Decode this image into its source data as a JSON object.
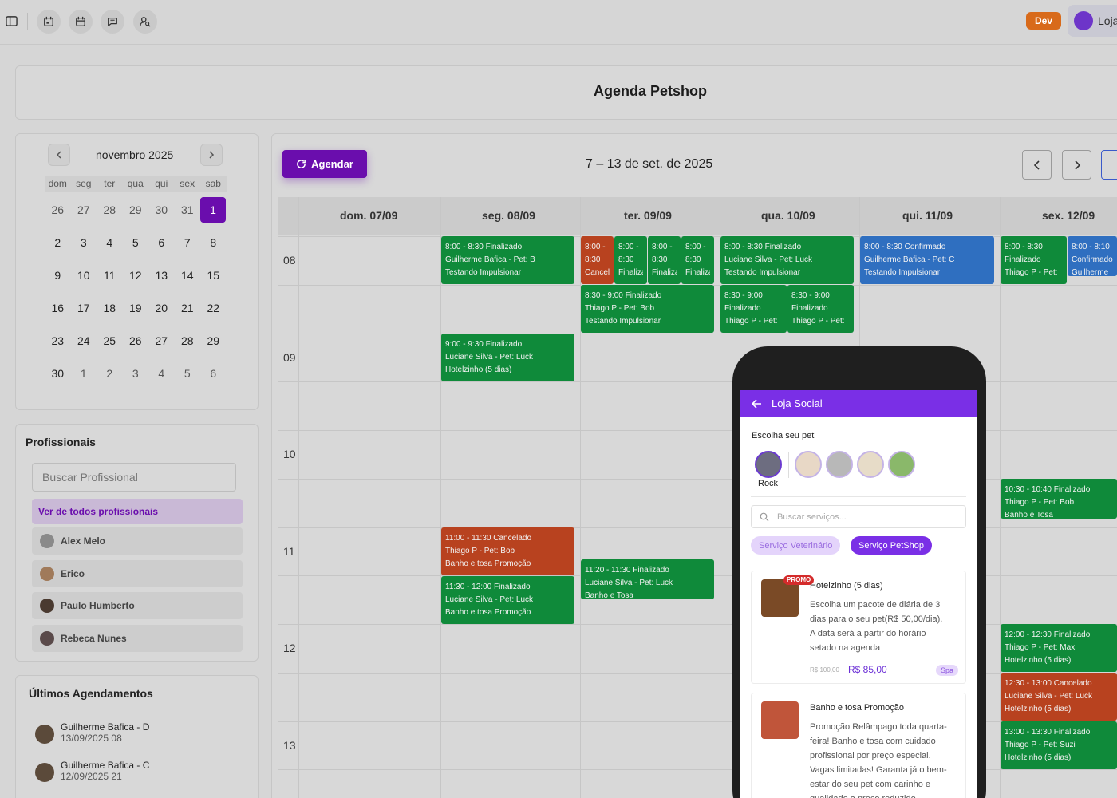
{
  "topbar": {
    "icons": [
      "sidebar-icon",
      "calendar-icon",
      "calendar-check-icon",
      "message-icon",
      "user-search-icon"
    ],
    "env_badge": "Dev",
    "user_label": "Loja"
  },
  "page": {
    "title": "Agenda Petshop"
  },
  "mini_calendar": {
    "month": "novembro 2025",
    "weekdays": [
      "dom",
      "seg",
      "ter",
      "qua",
      "qui",
      "sex",
      "sab"
    ],
    "days": [
      {
        "d": "26",
        "muted": true
      },
      {
        "d": "27",
        "muted": true
      },
      {
        "d": "28",
        "muted": true
      },
      {
        "d": "29",
        "muted": true
      },
      {
        "d": "30",
        "muted": true
      },
      {
        "d": "31",
        "muted": true
      },
      {
        "d": "1",
        "selected": true
      },
      {
        "d": "2"
      },
      {
        "d": "3"
      },
      {
        "d": "4"
      },
      {
        "d": "5"
      },
      {
        "d": "6"
      },
      {
        "d": "7"
      },
      {
        "d": "8"
      },
      {
        "d": "9"
      },
      {
        "d": "10"
      },
      {
        "d": "11"
      },
      {
        "d": "12"
      },
      {
        "d": "13"
      },
      {
        "d": "14"
      },
      {
        "d": "15"
      },
      {
        "d": "16"
      },
      {
        "d": "17"
      },
      {
        "d": "18"
      },
      {
        "d": "19"
      },
      {
        "d": "20"
      },
      {
        "d": "21"
      },
      {
        "d": "22"
      },
      {
        "d": "23"
      },
      {
        "d": "24"
      },
      {
        "d": "25"
      },
      {
        "d": "26"
      },
      {
        "d": "27"
      },
      {
        "d": "28"
      },
      {
        "d": "29"
      },
      {
        "d": "30"
      },
      {
        "d": "1",
        "muted": true
      },
      {
        "d": "2",
        "muted": true
      },
      {
        "d": "3",
        "muted": true
      },
      {
        "d": "4",
        "muted": true
      },
      {
        "d": "5",
        "muted": true
      },
      {
        "d": "6",
        "muted": true
      }
    ]
  },
  "profissionais": {
    "title": "Profissionais",
    "search_placeholder": "Buscar Profissional",
    "all_label": "Ver de todos profissionais",
    "items": [
      "Alex Melo",
      "Erico",
      "Paulo Humberto",
      "Rebeca Nunes"
    ]
  },
  "ultimos": {
    "title": "Últimos Agendamentos",
    "items": [
      {
        "name": "Guilherme Bafica - D",
        "date": "13/09/2025 08"
      },
      {
        "name": "Guilherme Bafica - C",
        "date": "12/09/2025 21"
      }
    ]
  },
  "agenda": {
    "agendar_label": "Agendar",
    "week_label": "7 – 13 de set. de 2025",
    "columns": [
      "dom. 07/09",
      "seg. 08/09",
      "ter. 09/09",
      "qua. 10/09",
      "qui. 11/09",
      "sex. 12/09"
    ],
    "hours": [
      "08",
      "09",
      "10",
      "11",
      "12",
      "13"
    ],
    "status_colors": {
      "Finalizado": "#0f8a3a",
      "Cancelado": "#b8421f",
      "Confirmado": "#2f6fc0"
    },
    "events": [
      {
        "status": "Finalizado",
        "lines": [
          "8:00 - 8:30 Finalizado",
          "Guilherme Bafica - Pet: B",
          "Testando Impulsionar"
        ]
      },
      {
        "status": "Cancelado",
        "lines": [
          "8:00 -",
          "8:30",
          "Cancela"
        ]
      },
      {
        "status": "Finalizado",
        "lines": [
          "8:00 -",
          "8:30",
          "Finaliza"
        ]
      },
      {
        "status": "Finalizado",
        "lines": [
          "8:00 -",
          "8:30",
          "Finaliza"
        ]
      },
      {
        "status": "Finalizado",
        "lines": [
          "8:00 -",
          "8:30",
          "Finaliza"
        ]
      },
      {
        "status": "Finalizado",
        "lines": [
          "8:30 - 9:00 Finalizado",
          "Thiago P - Pet: Bob",
          "Testando Impulsionar"
        ]
      },
      {
        "status": "Finalizado",
        "lines": [
          "8:00 - 8:30 Finalizado",
          "Luciane Silva - Pet: Luck",
          "Testando Impulsionar"
        ]
      },
      {
        "status": "Finalizado",
        "lines": [
          "8:30 - 9:00",
          "Finalizado",
          "Thiago P - Pet:"
        ]
      },
      {
        "status": "Finalizado",
        "lines": [
          "8:30 - 9:00",
          "Finalizado",
          "Thiago P - Pet:"
        ]
      },
      {
        "status": "Confirmado",
        "lines": [
          "8:00 - 8:30 Confirmado",
          "Guilherme Bafica - Pet: C",
          "Testando Impulsionar"
        ]
      },
      {
        "status": "Finalizado",
        "lines": [
          "8:00 - 8:30",
          "Finalizado",
          "Thiago P - Pet:"
        ]
      },
      {
        "status": "Confirmado",
        "lines": [
          "8:00 - 8:10",
          "Confirmado",
          "Guilherme"
        ]
      },
      {
        "status": "Finalizado",
        "lines": [
          "9:00 - 9:30 Finalizado",
          "Luciane Silva - Pet: Luck",
          "Hotelzinho (5 dias)"
        ]
      },
      {
        "status": "Finalizado",
        "lines": [
          "10:30 - 10:40 Finalizado",
          "Thiago P - Pet: Bob",
          "Banho e Tosa"
        ]
      },
      {
        "status": "Cancelado",
        "lines": [
          "11:00 - 11:30 Cancelado",
          "Thiago P - Pet: Bob",
          "Banho e tosa Promoção"
        ]
      },
      {
        "status": "Finalizado",
        "lines": [
          "11:30 - 12:00 Finalizado",
          "Luciane Silva - Pet: Luck",
          "Banho e tosa Promoção"
        ]
      },
      {
        "status": "Finalizado",
        "lines": [
          "11:20 - 11:30 Finalizado",
          "Luciane Silva - Pet: Luck",
          "Banho e Tosa"
        ]
      },
      {
        "status": "Finalizado",
        "lines": [
          "12:00 - 12:30 Finalizado",
          "Thiago P - Pet: Max",
          "Hotelzinho (5 dias)"
        ]
      },
      {
        "status": "Cancelado",
        "lines": [
          "12:30 - 13:00 Cancelado",
          "Luciane Silva - Pet: Luck",
          "Hotelzinho (5 dias)"
        ]
      },
      {
        "status": "Finalizado",
        "lines": [
          "13:00 - 13:30 Finalizado",
          "Thiago P - Pet: Suzi",
          "Hotelzinho (5 dias)"
        ]
      }
    ]
  },
  "phone": {
    "header_title": "Loja Social",
    "choose_pet": "Escolha seu pet",
    "selected_pet": "Rock",
    "search_placeholder": "Buscar serviços...",
    "chips": [
      "Serviço Veterinário",
      "Serviço PetShop"
    ],
    "services": [
      {
        "promo": "PROMO",
        "title": "Hotelzinho (5 dias)",
        "desc": [
          "Escolha um pacote de diária de 3",
          "dias para o seu pet(R$ 50,00/dia).",
          "A data será a partir do horário",
          "setado na agenda"
        ],
        "old_price": "R$ 100,00",
        "price": "R$ 85,00",
        "tag": "Spa"
      },
      {
        "title": "Banho e tosa Promoção",
        "desc": [
          "Promoção Relâmpago toda quarta-",
          "feira! Banho e tosa com cuidado",
          "profissional por preço especial.",
          "Vagas limitadas! Garanta já o bem-",
          "estar do seu pet com carinho e",
          "qualidade a preço reduzido"
        ]
      }
    ]
  }
}
